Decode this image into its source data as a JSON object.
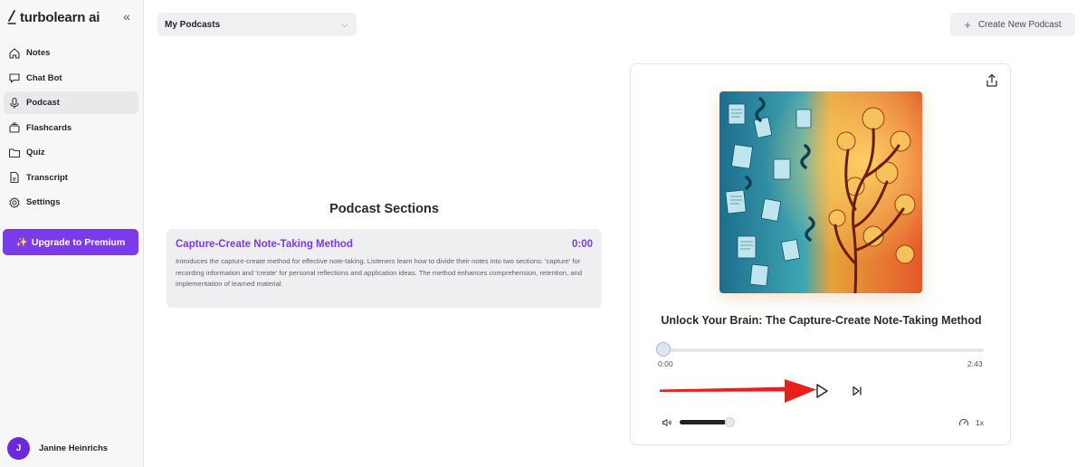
{
  "app": {
    "name": "turbolearn ai"
  },
  "sidebar": {
    "items": [
      {
        "label": "Notes",
        "icon": "home-icon"
      },
      {
        "label": "Chat Bot",
        "icon": "chat-icon"
      },
      {
        "label": "Podcast",
        "icon": "microphone-icon",
        "active": true
      },
      {
        "label": "Flashcards",
        "icon": "cards-icon"
      },
      {
        "label": "Quiz",
        "icon": "folder-icon"
      },
      {
        "label": "Transcript",
        "icon": "document-icon"
      },
      {
        "label": "Settings",
        "icon": "gear-icon"
      }
    ],
    "upgrade_label": "Upgrade to Premium",
    "upgrade_icon": "✨",
    "user": {
      "initial": "J",
      "name": "Janine Heinrichs"
    }
  },
  "header": {
    "podcast_select": "My Podcasts",
    "create_label": "Create New Podcast"
  },
  "sections": {
    "title": "Podcast Sections",
    "items": [
      {
        "title": "Capture-Create Note-Taking Method",
        "time": "0:00",
        "description": "Introduces the capture-create method for effective note-taking. Listeners learn how to divide their notes into two sections: 'capture' for recording information and 'create' for personal reflections and application ideas. The method enhances comprehension, retention, and implementation of learned material."
      }
    ]
  },
  "player": {
    "episode_title": "Unlock Your Brain: The Capture-Create Note-Taking Method",
    "current_time": "0:00",
    "duration": "2:43",
    "progress": 0,
    "volume": 0.85,
    "speed": "1x"
  },
  "colors": {
    "accent": "#7c3aed",
    "annotation": "#e8201c"
  }
}
